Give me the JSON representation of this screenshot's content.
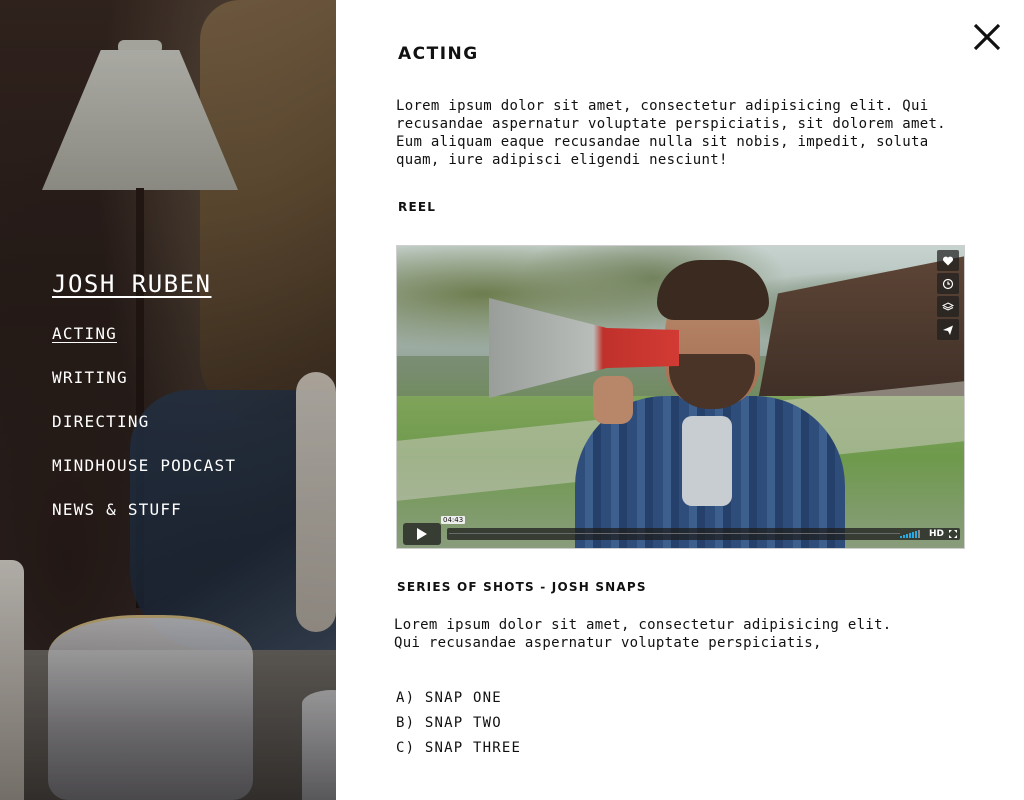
{
  "sidebar": {
    "site_title": "JOSH RUBEN",
    "nav": [
      {
        "label": "ACTING",
        "active": true
      },
      {
        "label": "WRITING",
        "active": false
      },
      {
        "label": "DIRECTING",
        "active": false
      },
      {
        "label": "MINDHOUSE PODCAST",
        "active": false
      },
      {
        "label": "NEWS & STUFF",
        "active": false
      }
    ]
  },
  "close_icon": "close-x-icon",
  "main": {
    "section_title": "ACTING",
    "intro": "Lorem ipsum dolor sit amet, consectetur adipisicing elit. Qui recusandae aspernatur voluptate perspiciatis, sit dolorem amet. Eum aliquam eaque recusandae nulla sit nobis, impedit, soluta quam, iure adipisci eligendi nesciunt!",
    "reel_label": "REEL",
    "video": {
      "timestamp": "04:43",
      "hd_label": "HD",
      "progress": 0,
      "tools": [
        "heart-icon",
        "clock-icon",
        "layers-icon",
        "send-icon"
      ],
      "accent_color": "#29a9e1"
    },
    "series_title": "SERIES OF SHOTS - JOSH SNAPS",
    "series_desc": "Lorem ipsum dolor sit amet, consectetur adipisicing elit. Qui recusandae aspernatur voluptate perspiciatis,",
    "snaps": [
      "A) SNAP ONE",
      "B) SNAP TWO",
      "C) SNAP THREE"
    ]
  }
}
